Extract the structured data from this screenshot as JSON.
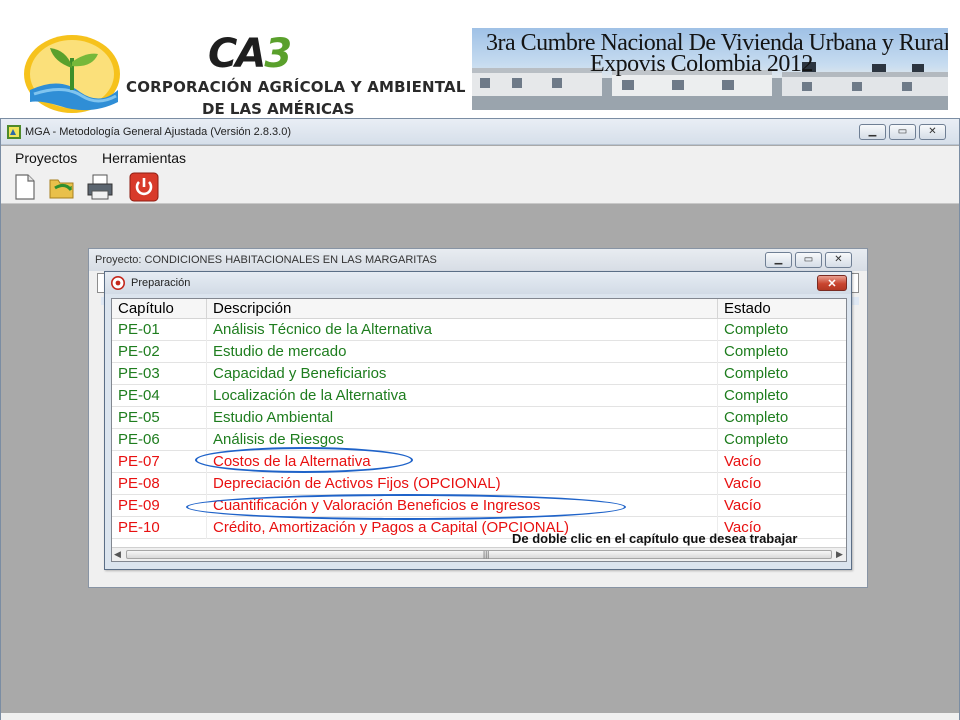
{
  "header": {
    "org_logo": {
      "brand": "CA3",
      "line1": "CORPORACIÓN AGRÍCOLA Y AMBIENTAL",
      "line2": "DE LAS AMÉRICAS"
    },
    "event_banner": {
      "line1": "3ra Cumbre Nacional De Vivienda Urbana y Rural",
      "line2": "Expovis Colombia 2012"
    }
  },
  "app_window": {
    "title": "MGA - Metodología General Ajustada (Versión 2.8.3.0)",
    "menu": [
      "Proyectos",
      "Herramientas"
    ],
    "toolbar": [
      {
        "icon": "new-document-icon"
      },
      {
        "icon": "open-folder-icon"
      },
      {
        "icon": "printer-icon"
      },
      {
        "icon": "power-icon"
      }
    ]
  },
  "project_window": {
    "title": "Proyecto: CONDICIONES HABITACIONALES EN LAS MARGARITAS"
  },
  "prep_dialog": {
    "title": "Preparación",
    "columns": {
      "chapter": "Capítulo",
      "description": "Descripción",
      "status": "Estado"
    },
    "rows": [
      {
        "chapter": "PE-01",
        "description": "Análisis Técnico de la Alternativa",
        "status": "Completo",
        "complete": true
      },
      {
        "chapter": "PE-02",
        "description": "Estudio de mercado",
        "status": "Completo",
        "complete": true
      },
      {
        "chapter": "PE-03",
        "description": "Capacidad y Beneficiarios",
        "status": "Completo",
        "complete": true
      },
      {
        "chapter": "PE-04",
        "description": "Localización de la Alternativa",
        "status": "Completo",
        "complete": true
      },
      {
        "chapter": "PE-05",
        "description": "Estudio Ambiental",
        "status": "Completo",
        "complete": true
      },
      {
        "chapter": "PE-06",
        "description": "Análisis de Riesgos",
        "status": "Completo",
        "complete": true
      },
      {
        "chapter": "PE-07",
        "description": "Costos de la Alternativa",
        "status": "Vacío",
        "complete": false
      },
      {
        "chapter": "PE-08",
        "description": "Depreciación de Activos Fijos (OPCIONAL)",
        "status": "Vacío",
        "complete": false
      },
      {
        "chapter": "PE-09",
        "description": "Cuantificación y Valoración Beneficios e Ingresos",
        "status": "Vacío",
        "complete": false
      },
      {
        "chapter": "PE-10",
        "description": "Crédito, Amortización y Pagos a Capital (OPCIONAL)",
        "status": "Vacío",
        "complete": false
      }
    ],
    "hint": "De doble clic en el capítulo que desea trabajar"
  },
  "colors": {
    "complete": "#1e7d1e",
    "empty": "#e81010",
    "highlight": "#1f63c9"
  }
}
